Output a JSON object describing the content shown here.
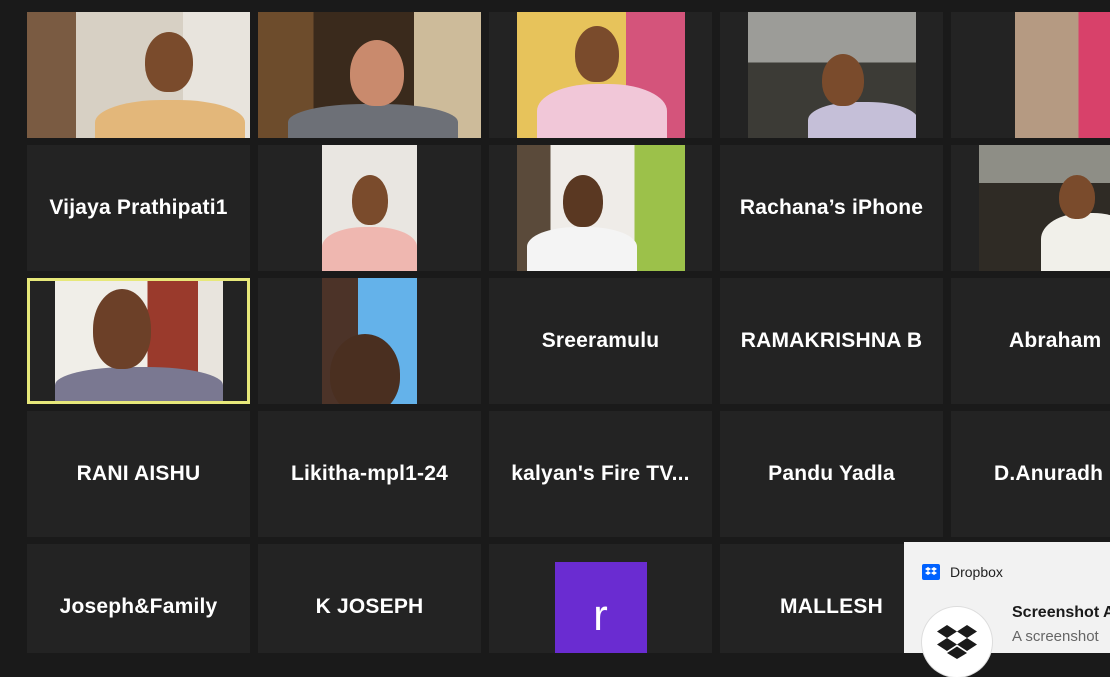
{
  "participants_row2_col1": "Vijaya Prathipati1",
  "participants_row2_col4": "Rachana’s iPhone",
  "participants_row3_col3": "Sreeramulu",
  "participants_row3_col4": "RAMAKRISHNA B",
  "participants_row3_col5": "Abraham",
  "participants_row4": [
    "RANI AISHU",
    "Likitha-mpl1-24",
    "kalyan's Fire TV...",
    "Pandu Yadla",
    "D.Anuradh"
  ],
  "participants_row5_col1": "Joseph&Family",
  "participants_row5_col2": "K JOSEPH",
  "participants_row5_col3_avatar": "r",
  "participants_row5_col4": "MALLESH",
  "toast": {
    "app": "Dropbox",
    "title": "Screenshot A",
    "subtitle": "A screenshot"
  },
  "colors": {
    "tile_bg": "#232323",
    "active_border": "#e7e87a",
    "avatar_bg": "#6a2cd1",
    "dropbox_blue": "#0061ff"
  }
}
